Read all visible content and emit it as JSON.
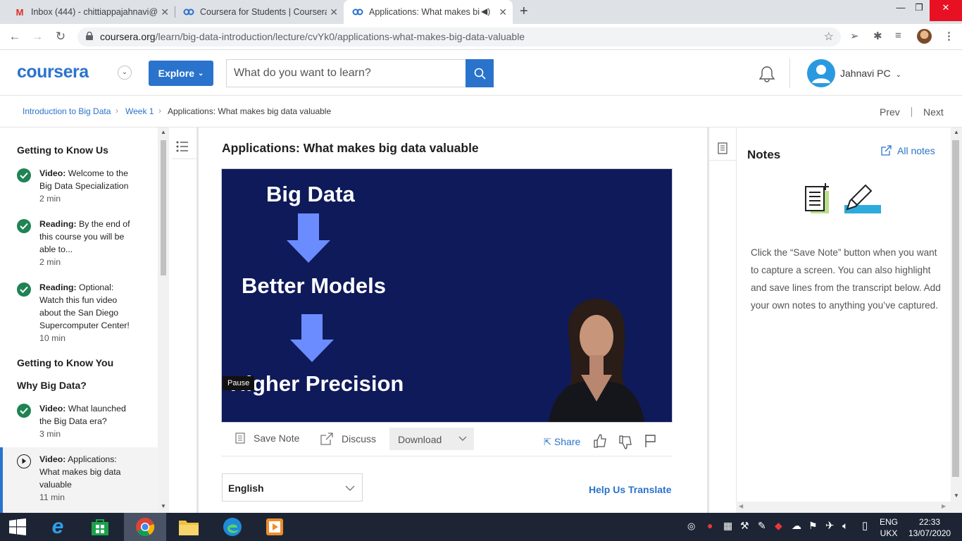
{
  "browser": {
    "tabs": [
      {
        "title": "Inbox (444) - chittiappajahnavi@",
        "icon": "gmail-icon"
      },
      {
        "title": "Coursera for Students | Coursera",
        "icon": "coursera-tab-icon"
      },
      {
        "title": "Applications: What makes bi",
        "icon": "coursera-tab-icon",
        "active": true
      }
    ],
    "url_host": "coursera.org",
    "url_path": "/learn/big-data-introduction/lecture/cvYk0/applications-what-makes-big-data-valuable"
  },
  "header": {
    "logo": "coursera",
    "explore_label": "Explore",
    "search_placeholder": "What do you want to learn?",
    "user_name": "Jahnavi PC"
  },
  "breadcrumb": {
    "course": "Introduction to Big Data",
    "week": "Week 1",
    "current": "Applications: What makes big data valuable",
    "prev": "Prev",
    "next": "Next"
  },
  "sidebar": {
    "sections": [
      "Getting to Know Us",
      "Getting to Know You",
      "Why Big Data?"
    ],
    "items": [
      {
        "type": "Video:",
        "title": "Welcome to the Big Data Specialization",
        "duration": "2 min",
        "status": "complete"
      },
      {
        "type": "Reading:",
        "title": "By the end of this course you will be able to...",
        "duration": "2 min",
        "status": "complete"
      },
      {
        "type": "Reading:",
        "title": "Optional: Watch this fun video about the San Diego Supercomputer Center!",
        "duration": "10 min",
        "status": "complete"
      },
      {
        "type": "Video:",
        "title": "What launched the Big Data era?",
        "duration": "3 min",
        "status": "complete"
      },
      {
        "type": "Video:",
        "title": "Applications: What makes big data valuable",
        "duration": "11 min",
        "status": "current"
      }
    ]
  },
  "lecture": {
    "title": "Applications: What makes big data valuable",
    "slide": {
      "line1": "Big Data",
      "line2": "Better Models",
      "line3": "Higher Precision"
    },
    "tooltip": "Pause",
    "save_note": "Save Note",
    "discuss": "Discuss",
    "download": "Download",
    "share": "Share",
    "language": "English",
    "help_translate": "Help Us Translate"
  },
  "notes": {
    "title": "Notes",
    "all_notes": "All notes",
    "body": "Click the “Save Note” button when you want to capture a screen. You can also highlight and save lines from the transcript below. Add your own notes to anything you’ve captured."
  },
  "taskbar": {
    "lang_line1": "ENG",
    "lang_line2": "UKX",
    "time": "22:33",
    "date": "13/07/2020"
  },
  "colors": {
    "brand_blue": "#2a73cc",
    "complete_green": "#1f8354",
    "video_bg": "#0f1a5a",
    "arrow_blue": "#6b8cff"
  }
}
